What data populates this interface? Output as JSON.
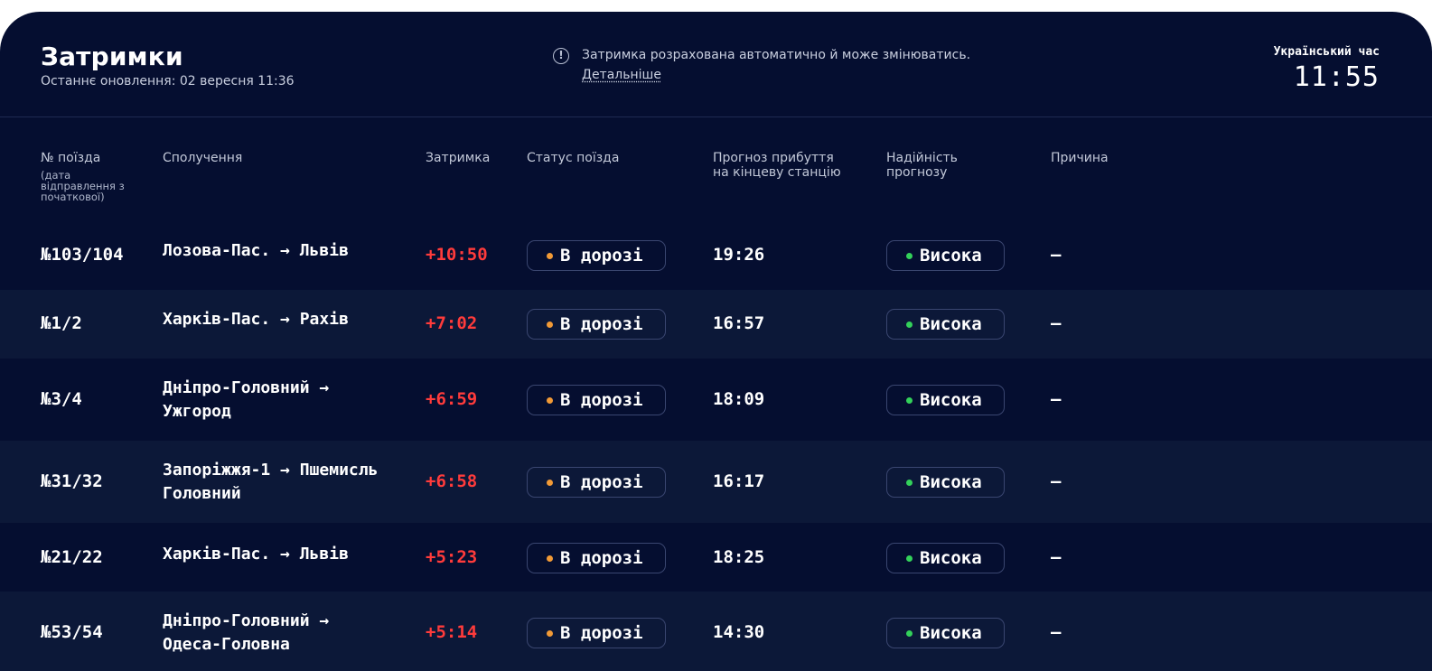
{
  "header": {
    "title": "Затримки",
    "updated": "Останнє оновлення: 02 вересня 11:36",
    "notice_icon": "info-icon",
    "notice_text": "Затримка розрахована автоматично й може змінюватись.",
    "notice_link": "Детальніше",
    "clock_label": "Український час",
    "clock_time": "11:55"
  },
  "columns": {
    "train": "№ поїзда",
    "train_sub": "(дата відправлення з початкової)",
    "route": "Сполучення",
    "delay": "Затримка",
    "status": "Статус поїзда",
    "eta": "Прогноз прибуття на кінцеву станцію",
    "reliability": "Надійність прогнозу",
    "reason": "Причина"
  },
  "colors": {
    "background": "#050e30",
    "row_alt": "#0c1838",
    "delay": "#ff3b3b",
    "status_dot": "#f29a36",
    "reliability_dot": "#33d15a"
  },
  "rows": [
    {
      "train": "№103/104",
      "route": "Лозова-Пас. → Львів",
      "delay": "+10:50",
      "status": "В дорозі",
      "eta": "19:26",
      "reliability": "Висока",
      "reason": "—"
    },
    {
      "train": "№1/2",
      "route": "Харків-Пас. → Рахів",
      "delay": "+7:02",
      "status": "В дорозі",
      "eta": "16:57",
      "reliability": "Висока",
      "reason": "—"
    },
    {
      "train": "№3/4",
      "route": "Дніпро-Головний → Ужгород",
      "delay": "+6:59",
      "status": "В дорозі",
      "eta": "18:09",
      "reliability": "Висока",
      "reason": "—"
    },
    {
      "train": "№31/32",
      "route": "Запоріжжя-1 → Пшемисль Головний",
      "delay": "+6:58",
      "status": "В дорозі",
      "eta": "16:17",
      "reliability": "Висока",
      "reason": "—"
    },
    {
      "train": "№21/22",
      "route": "Харків-Пас. → Львів",
      "delay": "+5:23",
      "status": "В дорозі",
      "eta": "18:25",
      "reliability": "Висока",
      "reason": "—"
    },
    {
      "train": "№53/54",
      "route": "Дніпро-Головний → Одеса-Головна",
      "delay": "+5:14",
      "status": "В дорозі",
      "eta": "14:30",
      "reliability": "Висока",
      "reason": "—"
    }
  ]
}
